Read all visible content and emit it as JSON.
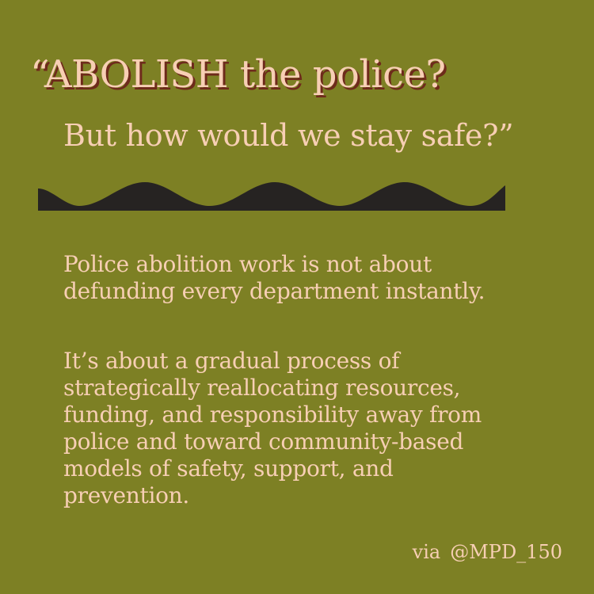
{
  "headline": {
    "line1": "“ABOLISH the police?",
    "line2": "But how would we stay safe?”"
  },
  "body": {
    "paragraph1": [
      "Police abolition work is not about",
      "defunding every department instantly."
    ],
    "paragraph2": [
      "It’s about a gradual process of",
      "strategically reallocating resources,",
      "funding, and responsibility away from",
      "police and toward community-based",
      "models of safety, support, and",
      "prevention."
    ]
  },
  "credit": {
    "via": "via",
    "handle": "@MPD_150"
  },
  "colors": {
    "background": "#7d8024",
    "text": "#f7cfb4",
    "shadow": "#6e2a1b",
    "wave": "#262322"
  },
  "icons": {
    "divider": "wave-divider-icon"
  }
}
